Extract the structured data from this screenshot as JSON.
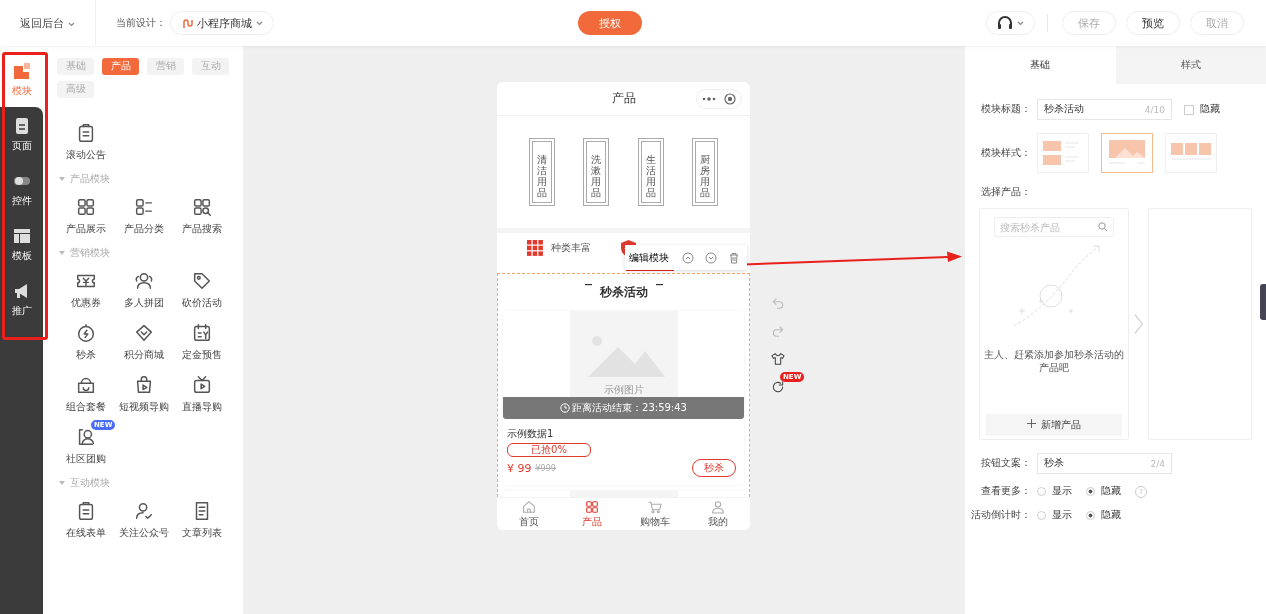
{
  "top_bar": {
    "back": "返回后台",
    "design_label": "当前设计：",
    "design": "小程序商城",
    "authorize": "授权",
    "buttons": [
      {
        "label": "保存",
        "kind": "muted"
      },
      {
        "label": "预览",
        "kind": "normal"
      },
      {
        "label": "取消",
        "kind": "muted"
      }
    ]
  },
  "rail": [
    {
      "label": "模块",
      "selected": true
    },
    {
      "label": "页面",
      "selected": false
    },
    {
      "label": "控件",
      "selected": false
    },
    {
      "label": "模板",
      "selected": false
    },
    {
      "label": "推广",
      "selected": false
    }
  ],
  "chips": [
    {
      "label": "基础",
      "selected": false
    },
    {
      "label": "产品",
      "selected": true
    },
    {
      "label": "营销",
      "selected": false
    },
    {
      "label": "互动",
      "selected": false
    },
    {
      "label": "高级",
      "selected": false
    }
  ],
  "sections": [
    {
      "items": [
        {
          "label": "滚动公告"
        }
      ]
    },
    {
      "title": "产品模块",
      "items": [
        {
          "label": "产品展示"
        },
        {
          "label": "产品分类"
        },
        {
          "label": "产品搜索"
        }
      ]
    },
    {
      "title": "营销模块",
      "items": [
        {
          "label": "优惠券"
        },
        {
          "label": "多人拼团"
        },
        {
          "label": "砍价活动"
        },
        {
          "label": "秒杀"
        },
        {
          "label": "积分商城"
        },
        {
          "label": "定金预售"
        },
        {
          "label": "组合套餐"
        },
        {
          "label": "短视频导购"
        },
        {
          "label": "直播导购"
        },
        {
          "label": "社区团购",
          "badge": "NEW"
        }
      ]
    },
    {
      "title": "互动模块",
      "items": [
        {
          "label": "在线表单"
        },
        {
          "label": "关注公众号"
        },
        {
          "label": "文章列表"
        }
      ]
    }
  ],
  "phone": {
    "title": "产品",
    "categories": [
      "清洁用品",
      "洗漱用品",
      "生活用品",
      "厨房用品"
    ],
    "feature": "种类丰富",
    "toolbar": "编辑模块",
    "module_title": "秒杀活动",
    "card": {
      "image_caption": "示例图片",
      "countdown": "距离活动结束：23:59:43",
      "name": "示例数据1",
      "sold": "已抢0%",
      "level": 0,
      "price": "¥ 99",
      "original_price": "¥999",
      "button": "秒杀"
    },
    "tabs": [
      {
        "label": "首页",
        "selected": false
      },
      {
        "label": "产品",
        "selected": true
      },
      {
        "label": "购物车",
        "selected": false
      },
      {
        "label": "我的",
        "selected": false
      }
    ]
  },
  "side_tools": [
    {
      "kind": "undo"
    },
    {
      "kind": "redo"
    },
    {
      "kind": "shirt"
    },
    {
      "kind": "refresh",
      "badge": "NEW"
    }
  ],
  "settings": {
    "tabs": [
      {
        "label": "基础",
        "selected": true
      },
      {
        "label": "样式",
        "selected": false
      }
    ],
    "title_label": "模块标题：",
    "title_value": "秒杀活动",
    "title_count": "4/10",
    "hide_label": "隐藏",
    "hide_checked": false,
    "style_label": "模块样式：",
    "styles": [
      {
        "kind": "list",
        "selected": false
      },
      {
        "kind": "big",
        "selected": true
      },
      {
        "kind": "grid",
        "selected": false
      }
    ],
    "product_label": "选择产品：",
    "search_placeholder": "搜索秒杀产品",
    "empty_text": "主人、赶紧添加参加秒杀活动的产品吧",
    "add_button": "新增产品",
    "button_label": "按钮文案：",
    "button_value": "秒杀",
    "button_count": "2/4",
    "radios": [
      {
        "label": "查看更多：",
        "options": [
          {
            "label": "显示",
            "selected": false
          },
          {
            "label": "隐藏",
            "selected": true
          }
        ],
        "help": "?"
      },
      {
        "label": "活动倒计时：",
        "options": [
          {
            "label": "显示",
            "selected": false
          },
          {
            "label": "隐藏",
            "selected": true
          }
        ]
      }
    ]
  }
}
